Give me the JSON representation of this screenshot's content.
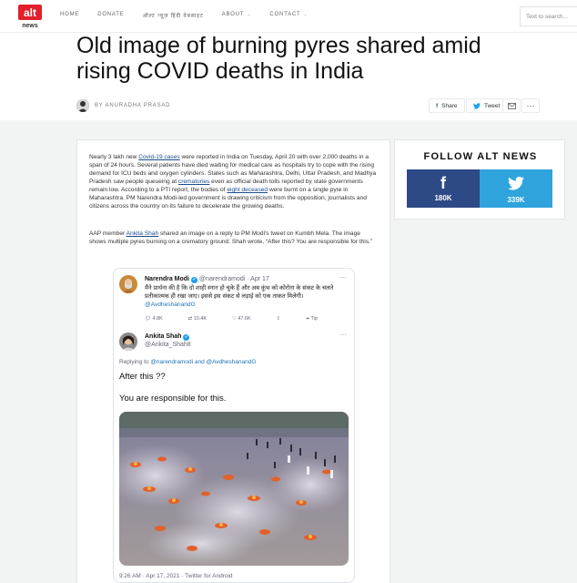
{
  "header": {
    "nav": [
      "HOME",
      "DONATE",
      "ऑल्ट न्यूज़ हिंदी वेबसाइट",
      "ABOUT",
      "CONTACT"
    ],
    "search_placeholder": "Text to search..."
  },
  "article": {
    "title": "Old image of burning pyres shared amid rising COVID deaths in India",
    "byline": "BY ANURADHA PRASAD",
    "share": {
      "facebook": "Share",
      "twitter": "Tweet"
    },
    "para1": {
      "a": "Nearly 3 lakh new ",
      "link1": "Covid-19 cases",
      "b": " were reported in India on Tuesday, April 20 with over 2,000 deaths in a span of 24 hours. Several patients have died waiting for medical care as hospitals try to cope with the rising demand for ICU beds and oxygen cylinders. States such as Maharashtra, Delhi, Uttar Pradesh, and Madhya Pradesh saw people queueing at ",
      "link2": "crematories",
      "c": " even as official death tolls reported by state governments remain low. According to a PTI report, the bodies of ",
      "link3": "eight deceased",
      "d": " were burnt on a single pyre in Maharashtra. PM Narendra Modi-led government is drawing criticism from the opposition, journalists and citizens across the country on its failure to decelerate the growing deaths."
    },
    "para2": {
      "a": "AAP member ",
      "link1": "Ankita Shah",
      "b": " shared an image on a reply to PM Modi's tweet on Kumbh Mela. The image shows multiple pyres burning on a crematory ground. Shah wrote, “After this? You are responsible for this.”"
    }
  },
  "sidebar": {
    "title": "FOLLOW ALT NEWS",
    "facebook_count": "180K",
    "twitter_count": "339K"
  },
  "tweet": {
    "parent": {
      "name": "Narendra Modi",
      "handle": "@narendramodi · Apr 17",
      "text": "मैंने प्रार्थना की है कि दो शाही स्नान हो चुके हैं और अब कुंभ को कोरोना के संकट के चलते प्रतीकात्मक ही रखा जाए। इससे इस संकट से लड़ाई को एक ताकत मिलेगी।",
      "mention": "@AvdheshanandG",
      "replies": "4.8K",
      "retweets": "10.4K",
      "likes": "47.6K",
      "tip": "Tip"
    },
    "reply": {
      "name": "Ankita Shah",
      "handle": "@Ankita_Shah8",
      "replying_label": "Replying to ",
      "replying_users": "@narendramodi and @AvdheshanandG",
      "line1": "After this ??",
      "line2": "You are responsible for this.",
      "meta": "9:26 AM · Apr 17, 2021 · Twitter for Android"
    }
  },
  "colors": {
    "link": "#1a4b8c",
    "facebook": "#2d4a86",
    "twitter": "#2ea3dc",
    "verified": "#1d9bf0",
    "logo_red": "#e0202a"
  }
}
